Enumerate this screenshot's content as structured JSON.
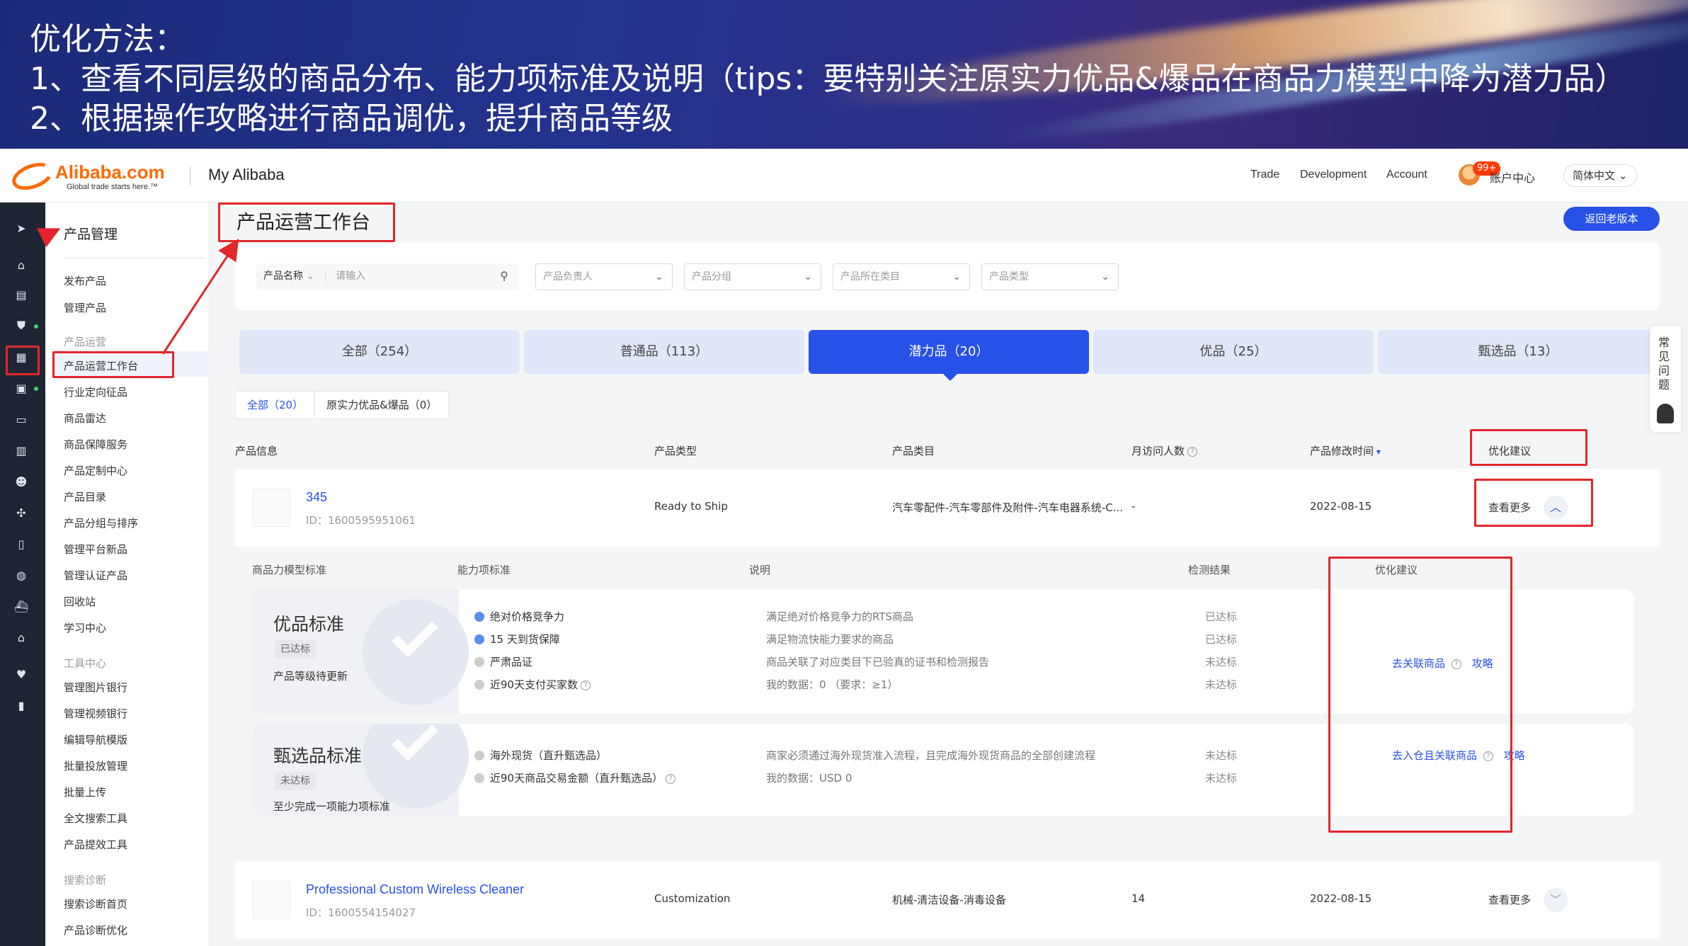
{
  "banner": {
    "line1": "优化方法：",
    "line2": "1、查看不同层级的商品分布、能力项标准及说明（tips：要特别关注原实力优品&爆品在商品力模型中降为潜力品）",
    "line3": "2、根据操作攻略进行商品调优，提升商品等级"
  },
  "topnav": {
    "logo_text": "Alibaba.com",
    "logo_slogan": "Global trade starts here.™",
    "site_title": "My Alibaba",
    "links": [
      "Trade",
      "Development",
      "Account"
    ],
    "badge": "99+",
    "user_center": "账户中心",
    "language": "简体中文"
  },
  "sidemenu": {
    "title": "产品管理",
    "items_top": [
      "发布产品",
      "管理产品"
    ],
    "group_ops": "产品运营",
    "items_ops": [
      "产品运营工作台",
      "行业定向征品",
      "商品雷达",
      "商品保障服务",
      "产品定制中心",
      "产品目录",
      "产品分组与排序",
      "管理平台新品",
      "管理认证产品",
      "回收站",
      "学习中心"
    ],
    "group_tools": "工具中心",
    "items_tools": [
      "管理图片银行",
      "管理视频银行",
      "编辑导航模版",
      "批量投放管理",
      "批量上传",
      "全文搜索工具",
      "产品提效工具"
    ],
    "group_diag": "搜索诊断",
    "items_diag": [
      "搜索诊断首页",
      "产品诊断优化"
    ]
  },
  "main": {
    "page_title": "产品运营工作台",
    "old_version": "返回老版本",
    "filters": {
      "name_label": "产品名称",
      "name_placeholder": "请输入",
      "owner": "产品负责人",
      "group": "产品分组",
      "category": "产品所在类目",
      "type": "产品类型"
    },
    "tabs": [
      "全部（254）",
      "普通品（113）",
      "潜力品（20）",
      "优品（25）",
      "甄选品（13）"
    ],
    "active_tab": 2,
    "subtabs": [
      "全部（20）",
      "原实力优品&爆品（0）"
    ],
    "columns": [
      "产品信息",
      "产品类型",
      "产品类目",
      "月访问人数",
      "产品修改时间",
      "优化建议"
    ],
    "products": [
      {
        "name": "345",
        "id": "ID：1600595951061",
        "type": "Ready to Ship",
        "category": "汽车零配件-汽车零部件及附件-汽车电器系统-C...",
        "visitors": "-",
        "modified": "2022-08-15",
        "action": "查看更多"
      },
      {
        "name": "Professional Custom Wireless Cleaner",
        "id": "ID：1600554154027",
        "type": "Customization",
        "category": "机械-清洁设备-消毒设备",
        "visitors": "14",
        "modified": "2022-08-15",
        "action": "查看更多"
      }
    ],
    "detail": {
      "headers": [
        "商品力模型标准",
        "能力项标准",
        "说明",
        "检测结果",
        "优化建议"
      ],
      "standards": [
        {
          "title": "优品标准",
          "status": "已达标",
          "note": "产品等级待更新",
          "abilities": [
            "绝对价格竞争力",
            "15 天到货保障",
            "严肃品证",
            "近90天支付买家数"
          ],
          "descriptions": [
            "满足绝对价格竞争力的RTS商品",
            "满足物流快能力要求的商品",
            "商品关联了对应类目下已验真的证书和检测报告",
            "我的数据：0 （要求：≥1）"
          ],
          "results": [
            "已达标",
            "已达标",
            "未达标",
            "未达标"
          ],
          "suggestion": "去关联商品",
          "guide": "攻略"
        },
        {
          "title": "甄选品标准",
          "status": "未达标",
          "note": "至少完成一项能力项标准",
          "abilities": [
            "海外现货（直升甄选品）",
            "近90天商品交易金额（直升甄选品）"
          ],
          "descriptions": [
            "商家必须通过海外现货准入流程，且完成海外现货商品的全部创建流程",
            "我的数据：USD 0"
          ],
          "results": [
            "未达标",
            "未达标"
          ],
          "suggestion": "去入仓且关联商品",
          "guide": "攻略"
        }
      ]
    }
  },
  "faq": "常见问题",
  "colors": {
    "primary": "#2851e8",
    "annotation_red": "#e3262b",
    "alibaba_orange": "#ff6a00",
    "rail_dark": "#1e2634"
  }
}
